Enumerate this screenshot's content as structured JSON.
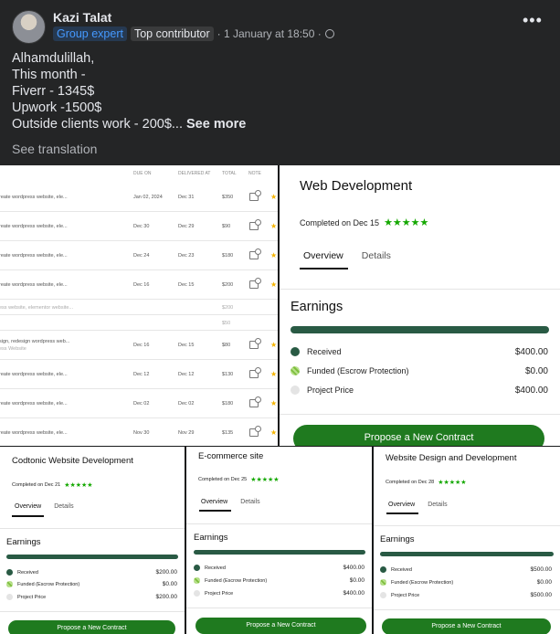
{
  "post": {
    "author": "Kazi Talat",
    "badges": [
      "Group expert",
      "Top contributor"
    ],
    "timestamp": "· 1 January at 18:50 ·",
    "menu_icon": "more-dots-icon",
    "lines": [
      "Alhamdulillah,",
      "This month -",
      "Fiverr - 1345$",
      "Upwork -1500$",
      "Outside clients work - 200$..."
    ],
    "see_more": "See more",
    "see_translation": "See translation"
  },
  "orders": {
    "headers": {
      "due": "DUE ON",
      "delivered": "DELIVERED AT",
      "total": "TOTAL",
      "note": "NOTE"
    },
    "rows": [
      {
        "desc": "reate wordpress website, ele...",
        "due": "Jan 02, 2024",
        "delivered": "Dec 31",
        "total": "$350"
      },
      {
        "desc": "reate wordpress website, ele...",
        "due": "Dec 30",
        "delivered": "Dec 29",
        "total": "$90"
      },
      {
        "desc": "reate wordpress website, ele...",
        "due": "Dec 24",
        "delivered": "Dec 23",
        "total": "$180"
      },
      {
        "desc": "reate wordpress website, ele...",
        "due": "Dec 16",
        "delivered": "Dec 15",
        "total": "$200"
      },
      {
        "desc": "ess website, elementor website...",
        "due": "",
        "delivered": "",
        "total": "$200"
      },
      {
        "desc": "",
        "due": "",
        "delivered": "",
        "total": "$50"
      },
      {
        "desc": "sign, redesign wordpress web...",
        "sub": "ess Website",
        "due": "Dec 16",
        "delivered": "Dec 15",
        "total": "$80"
      },
      {
        "desc": "reate wordpress website, ele...",
        "due": "Dec 12",
        "delivered": "Dec 12",
        "total": "$130"
      },
      {
        "desc": "reate wordpress website, ele...",
        "due": "Dec 02",
        "delivered": "Dec 02",
        "total": "$180"
      },
      {
        "desc": "reate wordpress website, ele...",
        "due": "Nov 30",
        "delivered": "Nov 29",
        "total": "$135"
      }
    ]
  },
  "cards": [
    {
      "title": "Web Development",
      "completed": "Completed on Dec 15",
      "rating": 5,
      "tabs": [
        "Overview",
        "Details"
      ],
      "earnings_title": "Earnings",
      "received_label": "Received",
      "received": "$400.00",
      "funded_label": "Funded (Escrow Protection)",
      "funded": "$0.00",
      "price_label": "Project Price",
      "price": "$400.00",
      "propose": "Propose a New Contract"
    },
    {
      "title": "Codtonic Website Development",
      "completed": "Completed on Dec 21",
      "rating": 5,
      "tabs": [
        "Overview",
        "Details"
      ],
      "earnings_title": "Earnings",
      "received_label": "Received",
      "received": "$200.00",
      "funded_label": "Funded (Escrow Protection)",
      "funded": "$0.00",
      "price_label": "Project Price",
      "price": "$200.00",
      "propose": "Propose a New Contract"
    },
    {
      "title": "E-commerce site",
      "completed": "Completed on Dec 25",
      "rating": 5,
      "tabs": [
        "Overview",
        "Details"
      ],
      "earnings_title": "Earnings",
      "received_label": "Received",
      "received": "$400.00",
      "funded_label": "Funded (Escrow Protection)",
      "funded": "$0.00",
      "price_label": "Project Price",
      "price": "$400.00",
      "propose": "Propose a New Contract"
    },
    {
      "title": "Website Design and Development",
      "completed": "Completed on Dec 28",
      "rating": 5,
      "tabs": [
        "Overview",
        "Details"
      ],
      "earnings_title": "Earnings",
      "received_label": "Received",
      "received": "$500.00",
      "funded_label": "Funded (Escrow Protection)",
      "funded": "$0.00",
      "price_label": "Project Price",
      "price": "$500.00",
      "propose": "Propose a New Contract"
    }
  ],
  "colors": {
    "accent_green": "#14a800",
    "bar_green": "#295a44",
    "button_green": "#1f7a1f",
    "bg_dark": "#242526"
  }
}
